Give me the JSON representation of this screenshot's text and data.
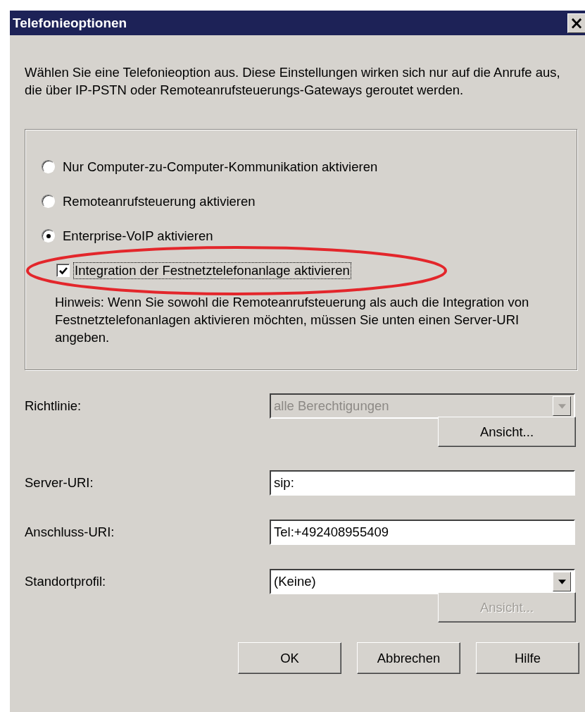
{
  "window": {
    "title": "Telefonieoptionen",
    "close": "×"
  },
  "intro": "Wählen Sie eine Telefonieoption aus. Diese Einstellungen wirken sich nur auf die Anrufe aus, die über IP-PSTN oder Remoteanrufsteuerungs-Gateways geroutet werden.",
  "options": [
    {
      "kind": "radio",
      "label": "Nur Computer-zu-Computer-Kommunikation aktivieren",
      "selected": false
    },
    {
      "kind": "radio",
      "label": "Remoteanrufsteuerung aktivieren",
      "selected": false
    },
    {
      "kind": "radio",
      "label": "Enterprise-VoIP aktivieren",
      "selected": true
    },
    {
      "kind": "checkbox",
      "label": "Integration der Festnetztelefonanlage aktivieren",
      "checked": true,
      "focused": true,
      "highlighted": true
    }
  ],
  "note": "Hinweis: Wenn Sie sowohl die Remoteanrufsteuerung als auch die Integration von Festnetztelefonanlagen aktivieren möchten, müssen Sie unten einen Server-URI angeben.",
  "fields": [
    {
      "kind": "dropdown",
      "label": "Richtlinie:",
      "value": "alle Berechtigungen",
      "disabled": true,
      "button": {
        "label": "Ansicht...",
        "disabled": false
      }
    },
    {
      "kind": "text",
      "label": "Server-URI:",
      "value": "sip:"
    },
    {
      "kind": "text",
      "label": "Anschluss-URI:",
      "value": "Tel:+492408955409"
    },
    {
      "kind": "dropdown",
      "label": "Standortprofil:",
      "value": "(Keine)",
      "disabled": false,
      "button": {
        "label": "Ansicht...",
        "disabled": true
      }
    }
  ],
  "buttons": [
    "OK",
    "Abbrechen",
    "Hilfe"
  ]
}
